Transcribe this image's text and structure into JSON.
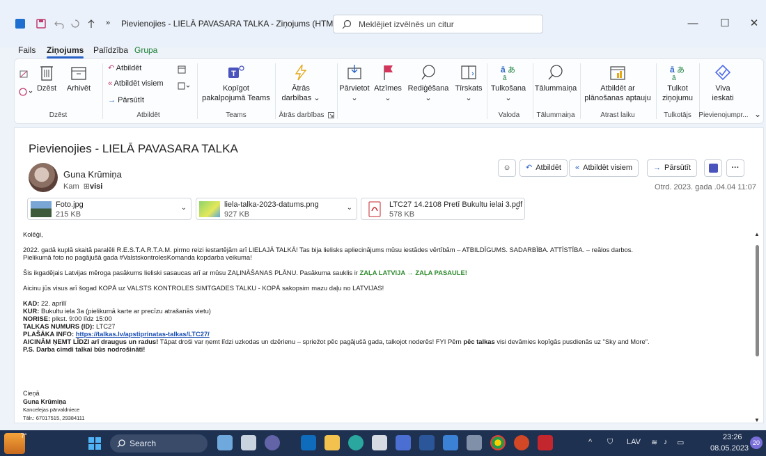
{
  "window": {
    "title": "Pievienojies - LIELĀ PAVASARA TALKA  -  Ziņojums (HTML)",
    "overflow": "»",
    "search_placeholder": "Meklējiet izvēlnēs un citur",
    "minimize": "—",
    "maximize": "☐",
    "close": "✕"
  },
  "menu": {
    "items": [
      "Fails",
      "Ziņojums",
      "Palīdzība",
      "Grupa"
    ],
    "active": "Ziņojums"
  },
  "ribbon": {
    "delete_group": {
      "delete": "Dzēst",
      "archive": "Arhivēt",
      "label": "Dzēst"
    },
    "reply_group": {
      "reply": "Atbildēt",
      "reply_all": "Atbildēt visiem",
      "forward": "Pārsūtīt",
      "label": "Atbildēt"
    },
    "teams_group": {
      "share": "Kopīgot pakalpojumā Teams",
      "label": "Teams"
    },
    "quick_group": {
      "quick": "Ātrās darbības",
      "label": "Ātrās darbības"
    },
    "move": "Pārvietot",
    "tags": "Atzīmes",
    "editing": "Rediģēšana",
    "immersive": "Tīrskats",
    "translate_btn": "Tulkošana",
    "lang_label": "Valoda",
    "zoom_btn": "Tālummaiņa",
    "zoom_label": "Tālummaiņa",
    "meeting_btn": "Atbildēt ar plānošanas aptauju",
    "meeting_label": "Atrast laiku",
    "translator_btn": "Tulkot ziņojumu",
    "translator_label": "Tulkotājs",
    "viva_btn": "Viva ieskati",
    "addins_label": "Pievienojumpr..."
  },
  "email": {
    "subject": "Pievienojies - LIELĀ PAVASARA TALKA",
    "sender": "Guna Krūmiņa",
    "to_label": "Kam",
    "to_value": "visi",
    "datetime": "Otrd. 2023. gada .04.04 11:07",
    "actions": {
      "reply": "Atbildēt",
      "reply_all": "Atbildēt visiem",
      "forward": "Pārsūtīt",
      "more": "···"
    },
    "attachments": [
      {
        "name": "Foto.jpg",
        "size": "215 KB"
      },
      {
        "name": "liela-talka-2023-datums.png",
        "size": "927 KB"
      },
      {
        "name": "LTC27 14.2108 Pretī Bukultu ielai 3.pdf",
        "size": "578 KB"
      }
    ],
    "body": {
      "greeting": "Kolēģi,",
      "p1_line1": "2022. gadā kuplā skaitā paralēli R.E.S.T.A.R.T.A.M. pirmo reizi iestartējām arī LIELAJĀ TALKĀ! Tas bija lielisks apliecinājums mūsu iestādes vērtībām – ATBILDĪGUMS. SADARBĪBA. ATTĪSTĪBA. – reālos darbos.",
      "p1_line2": "Pielikumā foto no pagājušā gada #ValstskontrolesKomanda kopdarba veikuma!",
      "p2_text": "Šis ikgadējais Latvijas mēroga pasākums lieliski sasaucas arī ar mūsu ZAĻINĀŠANAS PLĀNU. Pasākuma sauklis ir ",
      "p2_slogan": "ZAĻA LATVIJA → ZAĻA PASAULE!",
      "p3": "Aicinu jūs visus arī šogad KOPĀ uz VALSTS KONTROLES SIMTGADES TALKU - KOPĀ sakopsim mazu daļu no LATVIJAS!",
      "kad_label": "KAD:",
      "kad_value": " 22. aprīlī",
      "kur_label": "KUR:",
      "kur_value": " Bukultu iela 3a (pielikumā karte ar precīzu atrašanās vietu)",
      "norise_label": "NORISE:",
      "norise_value": " plkst. 9:00 līdz 15:00",
      "nr_label": "TALKAS NUMURS (ID):",
      "nr_value": " LTC27",
      "info_label": "PLAŠĀKA INFO: ",
      "info_link": "https://talkas.lv/apstiprinatas-talkas/LTC27/",
      "invite_bold": "AICINĀM ŅEMT LĪDZI arī draugus un radus!",
      "invite_text": " Tāpat droši var ņemt līdzi uzkodas un dzērienu – spriežot pēc pagājušā gada, talkojot noderēs! FYI Pērn ",
      "invite_bold2": "pēc talkas",
      "invite_text2": " visi devāmies kopīgās pusdienās uz \"Sky and More\".",
      "ps": "P.S. Darba cimdi talkai būs nodrošināti!"
    },
    "signature": {
      "closing": "Cieņā",
      "name": "Guna Krūmiņa",
      "position": "Kancelejas pārvaldniece",
      "phone": "Tālr.: 67017515, 29384111"
    }
  },
  "taskbar": {
    "weather": "7°",
    "search": "Search",
    "lang": "LAV",
    "time": "23:26",
    "date": "08.05.2023",
    "notifications": "20"
  },
  "colors": {
    "accent": "#2a63c7",
    "taskbar": "#1f3150",
    "green": "#2e8b2e"
  }
}
